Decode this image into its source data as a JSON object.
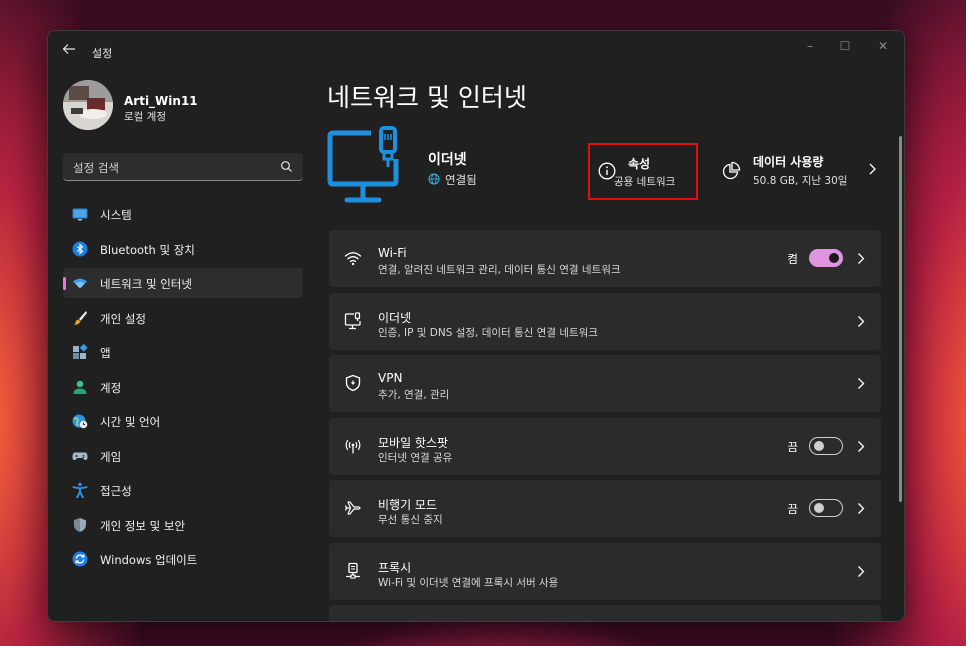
{
  "window": {
    "app_title": "설정",
    "controls": {
      "minimize": "–",
      "maximize": "☐",
      "close": "✕"
    }
  },
  "profile": {
    "name": "Arti_Win11",
    "account_type": "로컬 계정"
  },
  "search": {
    "placeholder": "설정 검색"
  },
  "sidebar": {
    "items": [
      {
        "label": "시스템",
        "icon": "monitor-icon"
      },
      {
        "label": "Bluetooth 및 장치",
        "icon": "bluetooth-icon"
      },
      {
        "label": "네트워크 및 인터넷",
        "icon": "wifi-icon",
        "active": true
      },
      {
        "label": "개인 설정",
        "icon": "brush-icon"
      },
      {
        "label": "앱",
        "icon": "apps-icon"
      },
      {
        "label": "계정",
        "icon": "person-icon"
      },
      {
        "label": "시간 및 언어",
        "icon": "globe-clock-icon"
      },
      {
        "label": "게임",
        "icon": "gamepad-icon"
      },
      {
        "label": "접근성",
        "icon": "accessibility-icon"
      },
      {
        "label": "개인 정보 및 보안",
        "icon": "shield-icon"
      },
      {
        "label": "Windows 업데이트",
        "icon": "update-icon"
      }
    ]
  },
  "main": {
    "title": "네트워크 및 인터넷",
    "ethernet": {
      "name": "이더넷",
      "status": "연결됨"
    },
    "properties": {
      "title": "속성",
      "subtitle": "공용 네트워크"
    },
    "data_usage": {
      "title": "데이터 사용량",
      "subtitle": "50.8 GB, 지난 30일"
    },
    "cards": [
      {
        "title": "Wi-Fi",
        "subtitle": "연결, 알려진 네트워크 관리, 데이터 통신 연결 네트워크",
        "icon": "wifi-icon",
        "toggle": {
          "label": "켬",
          "on": true
        }
      },
      {
        "title": "이더넷",
        "subtitle": "인증, IP 및 DNS 설정, 데이터 통신 연결 네트워크",
        "icon": "ethernet-icon"
      },
      {
        "title": "VPN",
        "subtitle": "추가, 연결, 관리",
        "icon": "vpn-shield-icon"
      },
      {
        "title": "모바일 핫스팟",
        "subtitle": "인터넷 연결 공유",
        "icon": "hotspot-icon",
        "toggle": {
          "label": "끔",
          "on": false
        }
      },
      {
        "title": "비행기 모드",
        "subtitle": "무선 통신 중지",
        "icon": "airplane-icon",
        "toggle": {
          "label": "끔",
          "on": false
        }
      },
      {
        "title": "프록시",
        "subtitle": "Wi-Fi 및 이더넷 연결에 프록시 서버 사용",
        "icon": "proxy-icon"
      }
    ]
  },
  "colors": {
    "accent": "#e095e2",
    "highlight_border": "#e30f0f",
    "ethernet_blue": "#1f8fe0"
  }
}
